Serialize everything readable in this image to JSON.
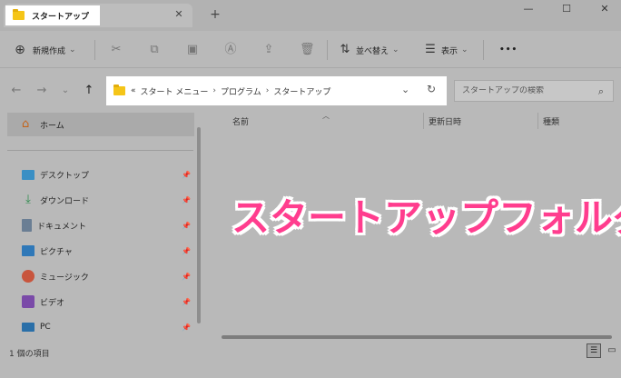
{
  "window": {
    "tab_title": "スタートアップ",
    "tab_close": "✕",
    "new_tab": "+",
    "minimize": "—",
    "maximize": "☐",
    "close": "✕"
  },
  "toolbar": {
    "new_label": "新規作成",
    "new_chevron": "⌄",
    "sort_label": "並べ替え",
    "sort_chevron": "⌄",
    "view_label": "表示",
    "view_chevron": "⌄",
    "more_label": "•••"
  },
  "address": {
    "overflow": "«",
    "crumbs": [
      "スタート メニュー",
      "プログラム",
      "スタートアップ"
    ],
    "separator": "›"
  },
  "search": {
    "placeholder": "スタートアップの検索"
  },
  "sidebar": {
    "home_label": "ホーム",
    "items": [
      {
        "label": "デスクトップ",
        "icon": "desktop-icon"
      },
      {
        "label": "ダウンロード",
        "icon": "download-icon"
      },
      {
        "label": "ドキュメント",
        "icon": "documents-icon"
      },
      {
        "label": "ピクチャ",
        "icon": "pictures-icon"
      },
      {
        "label": "ミュージック",
        "icon": "music-icon"
      },
      {
        "label": "ビデオ",
        "icon": "video-icon"
      },
      {
        "label": "PC",
        "icon": "pc-icon"
      }
    ]
  },
  "columns": {
    "name": "名前",
    "modified": "更新日時",
    "type": "種類"
  },
  "status": {
    "item_count": "1 個の項目"
  },
  "overlay": {
    "caption": "スタートアップフォルダ"
  },
  "colors": {
    "accent_caption": "#ff3d8e",
    "folder": "#f5c518"
  }
}
